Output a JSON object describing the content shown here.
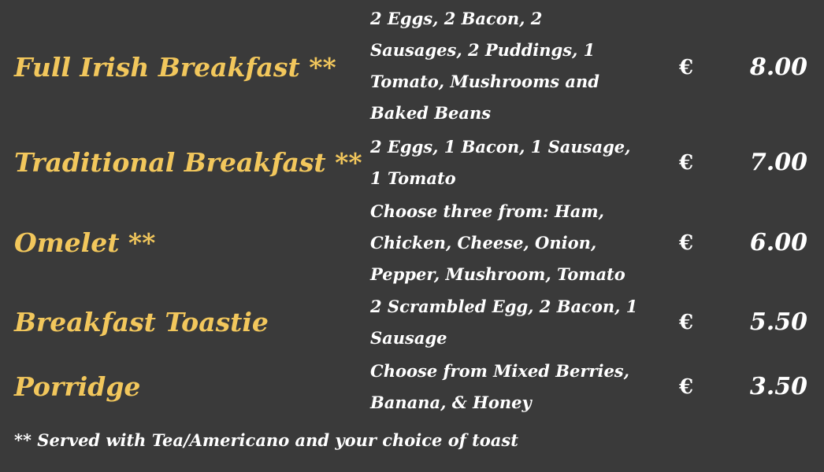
{
  "menu": {
    "items": [
      {
        "name": "Full Irish Breakfast **",
        "description": " 2 Eggs, 2 Bacon, 2\nSausages, 2 Puddings, 1\nTomato, Mushrooms and\nBaked Beans",
        "currency": "€",
        "price": "8.00"
      },
      {
        "name": "Traditional Breakfast **",
        "description": " 2 Eggs, 1 Bacon, 1 Sausage,\n1 Tomato",
        "currency": "€",
        "price": "7.00"
      },
      {
        "name": "Omelet **",
        "description": " Choose three from:  Ham,\nChicken, Cheese, Onion,\nPepper, Mushroom, Tomato",
        "currency": "€",
        "price": "6.00"
      },
      {
        "name": "Breakfast Toastie",
        "description": " 2 Scrambled Egg, 2 Bacon, 1\nSausage",
        "currency": "€",
        "price": "5.50"
      },
      {
        "name": "Porridge",
        "description": " Choose from Mixed Berries,\nBanana, & Honey",
        "currency": "€",
        "price": "3.50"
      }
    ],
    "footnote": "** Served with Tea/Americano and your choice of toast"
  },
  "colors": {
    "background": "#3a3a3a",
    "item_name": "#f2c75c",
    "text": "#ffffff"
  }
}
